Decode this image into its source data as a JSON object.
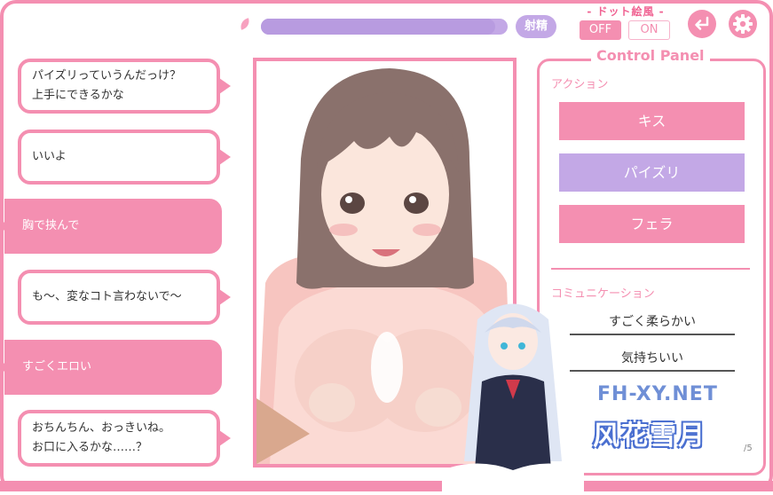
{
  "header": {
    "ejaculate_label": "射精",
    "dot_style_label": "- ドット絵風 -",
    "toggle_off_label": "OFF",
    "toggle_on_label": "ON",
    "gauge_level": 0.95
  },
  "chat": [
    {
      "text": "パイズリっていうんだっけ？\n上手にできるかな",
      "side": "character"
    },
    {
      "text": "いいよ",
      "side": "character"
    },
    {
      "text": "胸で挟んで",
      "side": "player"
    },
    {
      "text": "も～、変なコト言わないで～",
      "side": "character"
    },
    {
      "text": "すごくエロい",
      "side": "player"
    },
    {
      "text": "おちんちん、おっきいね。\nお口に入るかな……？",
      "side": "character"
    }
  ],
  "panel": {
    "title": "Control Panel",
    "action_label": "アクション",
    "actions": [
      "キス",
      "パイズリ",
      "フェラ"
    ],
    "selected_action": "パイズリ",
    "communication_label": "コミュニケーション",
    "communication_items": [
      "すごく柔らかい",
      "気持ちいい"
    ],
    "page_indicator": "/5"
  },
  "watermark": {
    "url": "FH-XY.NET",
    "name": "风花雪月"
  },
  "colors": {
    "pink": "#f48fb1",
    "lavender": "#c3a8e6",
    "skin": "#f8d8d4",
    "hair": "#8a716c"
  }
}
